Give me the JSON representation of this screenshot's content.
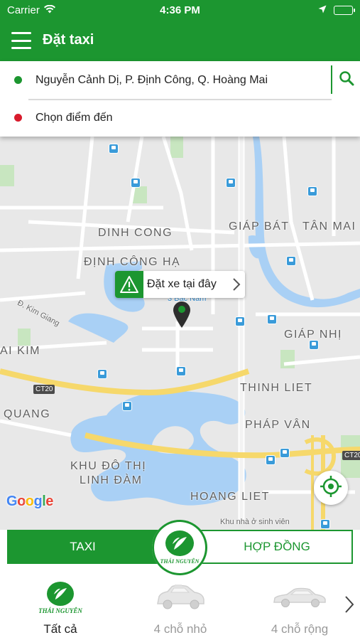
{
  "status_bar": {
    "carrier": "Carrier",
    "time": "4:36 PM"
  },
  "app_bar": {
    "title": "Đặt taxi",
    "color": "#1c9630"
  },
  "route": {
    "pickup": "Nguyễn Cảnh Dị, P. Định Công, Q. Hoàng Mai",
    "pickup_dot_color": "#1c9630",
    "destination_placeholder": "Chọn điểm đến",
    "destination_dot_color": "#d81b2c"
  },
  "map": {
    "callout_label": "Đặt xe tại đây",
    "google_logo": "Google",
    "labels": {
      "dinh_cong": "DINH CONG",
      "giap_bat": "GIÁP BÁT",
      "tan_mai": "TÂN MAI",
      "dinh_cong_ha": "ĐỊNH CÔNG HẠ",
      "giap_nhi": "GIÁP NHỊ",
      "ai_kim": "AI KIM",
      "thinh_liet": "THINH LIET",
      "quang": "QUANG",
      "phap_van": "PHÁP VÂN",
      "kdt_line1": "KHU ĐÔ THỊ",
      "kdt_line2": "LINH ĐÀM",
      "hoang_liet": "HOANG LIET",
      "kim_giang": "Đ. Kim Giang",
      "ben_xe": "3 Bắc Nam",
      "khu_nha": "Khu nhà ở sinh viên",
      "ct20_left": "CT20",
      "ct20_right": "CT20"
    }
  },
  "service_tabs": {
    "taxi": "TAXI",
    "contract": "HỢP ĐỒNG",
    "logo_text": "THÁI NGUYÊN"
  },
  "categories": [
    {
      "name": "Tất cả",
      "icon": "thai-nguyen-logo-icon",
      "logo_text": "THÁI NGUYÊN",
      "active": true
    },
    {
      "name": "4 chỗ nhỏ",
      "icon": "small-car-icon",
      "active": false
    },
    {
      "name": "4 chỗ rộng",
      "icon": "sedan-car-icon",
      "active": false
    }
  ]
}
